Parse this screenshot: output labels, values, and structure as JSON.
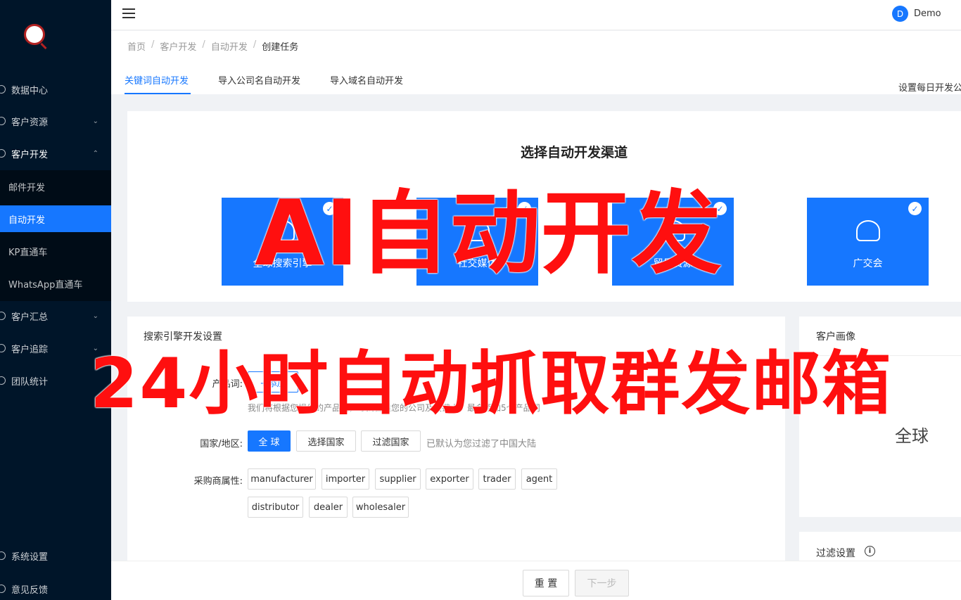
{
  "sidebar": {
    "items": [
      {
        "label": "数据中心",
        "icon": "dashboard-icon"
      },
      {
        "label": "客户资源",
        "icon": "user-icon",
        "arrow": "⌄"
      },
      {
        "label": "客户开发",
        "icon": "develop-icon",
        "arrow": "⌃"
      },
      {
        "label": "客户汇总",
        "icon": "user-group-icon",
        "arrow": "⌄"
      },
      {
        "label": "客户追踪",
        "icon": "target-icon",
        "arrow": "⌄"
      },
      {
        "label": "团队统计",
        "icon": "chart-icon"
      },
      {
        "label": "系统设置",
        "icon": "gear-icon"
      },
      {
        "label": "意见反馈",
        "icon": "feedback-icon"
      }
    ],
    "submenu": [
      "邮件开发",
      "自动开发",
      "KP直通车",
      "WhatsApp直通车"
    ]
  },
  "header": {
    "avatar_letter": "D",
    "user_name": "Demo"
  },
  "breadcrumb": [
    "首页",
    "客户开发",
    "自动开发",
    "创建任务"
  ],
  "tabs": [
    "关键词自动开发",
    "导入公司名自动开发",
    "导入域名自动开发"
  ],
  "daily_setting": "设置每日开发公",
  "channel_section": {
    "title": "选择自动开发渠道",
    "channels": [
      "全球搜索引擎",
      "社交媒体",
      "贸易资源",
      "广交会"
    ],
    "check": "✓"
  },
  "settings": {
    "title": "搜索引擎开发设置",
    "product_label": "产品词:",
    "add_button": "+添加",
    "product_hint": "我们将根据您提供的产品词，寻找合适您的公司及关键人，最多添加5个产品词",
    "country_label": "国家/地区:",
    "country_options": [
      "全 球",
      "选择国家",
      "过滤国家"
    ],
    "country_hint": "已默认为您过滤了中国大陆",
    "buyer_label": "采购商属性:",
    "buyer_types": [
      "manufacturer",
      "importer",
      "supplier",
      "exporter",
      "trader",
      "agent",
      "distributor",
      "dealer",
      "wholesaler"
    ]
  },
  "right_panel": {
    "title": "客户画像",
    "value": "全球"
  },
  "filter_panel": {
    "title": "过滤设置",
    "info": "i"
  },
  "footer": {
    "reset": "重 置",
    "next": "下一步"
  },
  "overlay": {
    "line1": "AI自动开发",
    "line2": "24小时自动抓取群发邮箱"
  }
}
